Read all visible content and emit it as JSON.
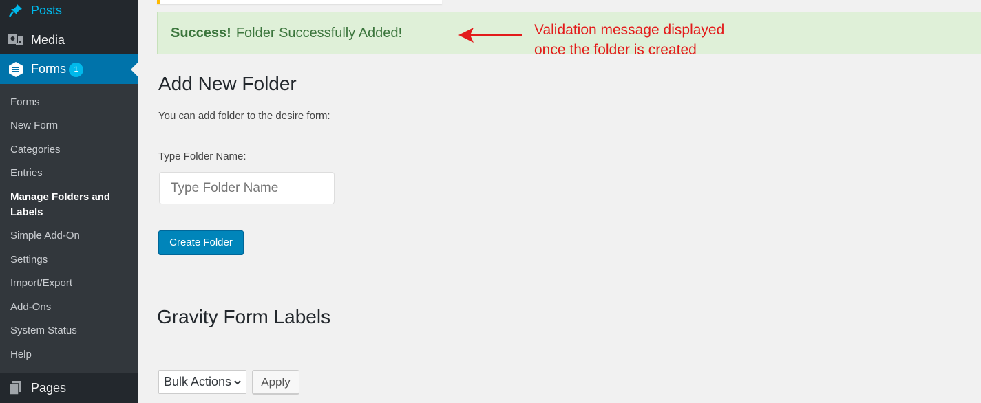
{
  "sidebar": {
    "posts": "Posts",
    "media": "Media",
    "forms": "Forms",
    "forms_badge": "1",
    "pages": "Pages",
    "submenu": [
      "Forms",
      "New Form",
      "Categories",
      "Entries",
      "Manage Folders and Labels",
      "Simple Add-On",
      "Settings",
      "Import/Export",
      "Add-Ons",
      "System Status",
      "Help"
    ]
  },
  "notice": {
    "strong": "Success!",
    "text": "Folder Successfully Added!"
  },
  "annotation": {
    "line1": "Validation message displayed",
    "line2": "once the folder is created"
  },
  "add_folder": {
    "title": "Add New Folder",
    "description": "You can add folder to the desire form:",
    "field_label": "Type Folder Name:",
    "placeholder": "Type Folder Name",
    "button": "Create Folder"
  },
  "labels_section": {
    "title": "Gravity Form Labels",
    "bulk_select": "Bulk Actions",
    "apply": "Apply"
  },
  "colors": {
    "accent": "#0073aa",
    "success_bg": "#dff0d8",
    "annotation": "#e31b1b"
  }
}
